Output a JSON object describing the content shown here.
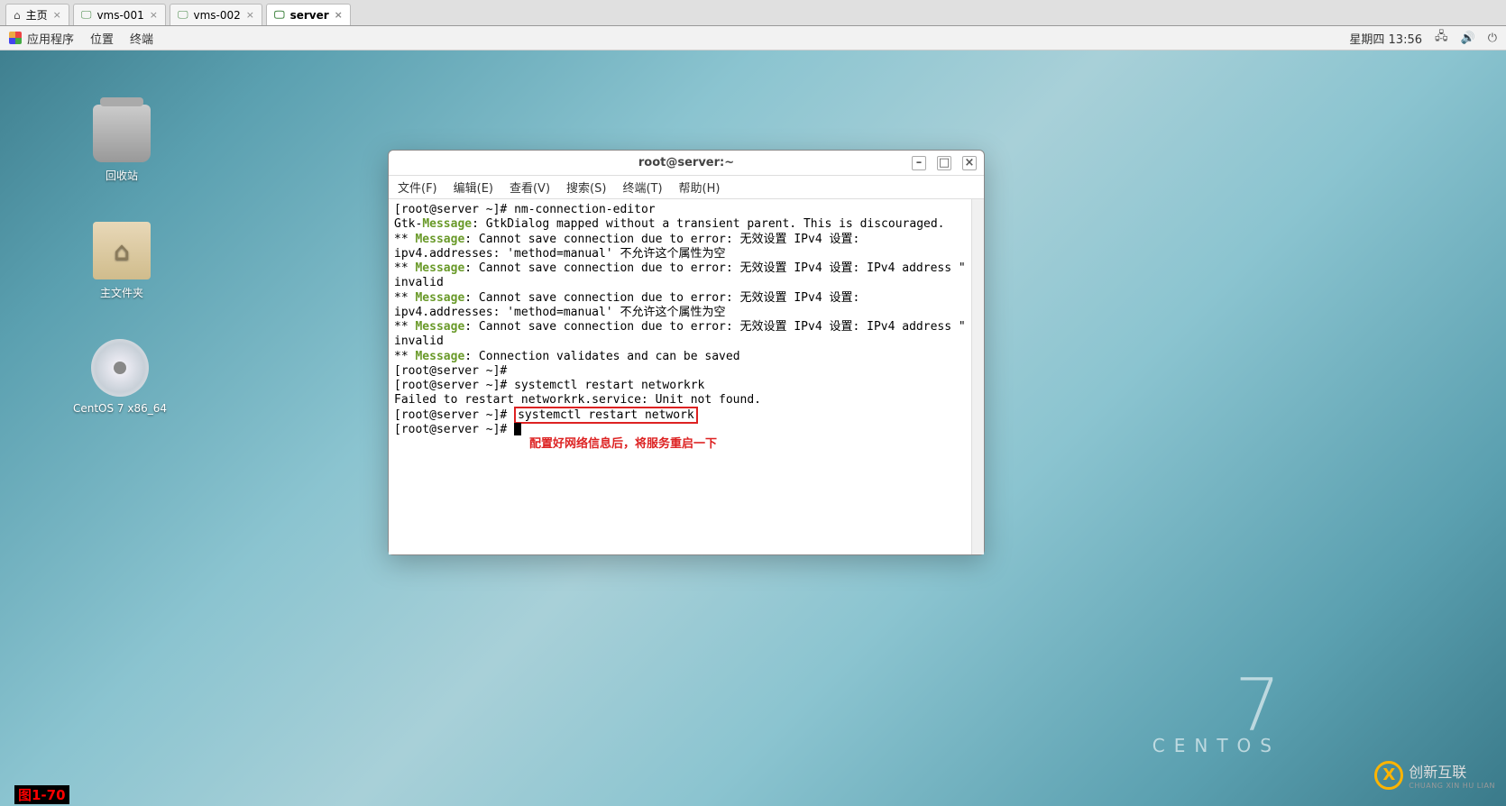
{
  "browser_tabs": [
    {
      "label": "主页",
      "icon": "⌂",
      "icon_class": "ic-home"
    },
    {
      "label": "vms-001",
      "icon": "🖵"
    },
    {
      "label": "vms-002",
      "icon": "🖵"
    },
    {
      "label": "server",
      "icon": "🖵",
      "active": true
    }
  ],
  "panel": {
    "apps": "应用程序",
    "places": "位置",
    "terminal": "终端",
    "datetime": "星期四 13:56"
  },
  "desktop_icons": {
    "trash": "回收站",
    "home": "主文件夹",
    "disc": "CentOS 7 x86_64"
  },
  "terminal": {
    "title": "root@server:~",
    "menu": {
      "file": "文件(F)",
      "edit": "编辑(E)",
      "view": "查看(V)",
      "search": "搜索(S)",
      "terminal": "终端(T)",
      "help": "帮助(H)"
    },
    "hl_cmd": "systemctl restart network",
    "annotation": "配置好网络信息后，将服务重启一下",
    "lines": [
      {
        "prompt": "[root@server ~]# ",
        "cmd": "nm-connection-editor"
      },
      {
        "pre": "Gtk-",
        "msg": "Message",
        "post": ": GtkDialog mapped without a transient parent. This is discouraged."
      },
      {
        "pre": "** ",
        "msg": "Message",
        "post": ": Cannot save connection due to error: 无效设置 IPv4 设置: ipv4.addresses: 'method=manual' 不允许这个属性为空"
      },
      {
        "pre": "** ",
        "msg": "Message",
        "post": ": Cannot save connection due to error: 无效设置 IPv4 设置: IPv4 address \" invalid"
      },
      {
        "pre": "** ",
        "msg": "Message",
        "post": ": Cannot save connection due to error: 无效设置 IPv4 设置: ipv4.addresses: 'method=manual' 不允许这个属性为空"
      },
      {
        "pre": "** ",
        "msg": "Message",
        "post": ": Cannot save connection due to error: 无效设置 IPv4 设置: IPv4 address \" invalid"
      },
      {
        "pre": "** ",
        "msg": "Message",
        "post": ": Connection validates and can be saved"
      },
      {
        "prompt": "[root@server ~]# ",
        "cmd": ""
      },
      {
        "prompt": "[root@server ~]# ",
        "cmd": "systemctl restart networkrk"
      },
      {
        "plain": "Failed to restart networkrk.service: Unit not found."
      },
      {
        "prompt": "[root@server ~]# ",
        "hl": true
      },
      {
        "prompt": "[root@server ~]# ",
        "cursor": true
      }
    ]
  },
  "centos": {
    "version": "7",
    "name": "CENTOS"
  },
  "watermark": {
    "cn": "创新互联",
    "en": "CHUANG XIN HU LIAN",
    "logo_letter": "X"
  },
  "figcap": "图1-70"
}
